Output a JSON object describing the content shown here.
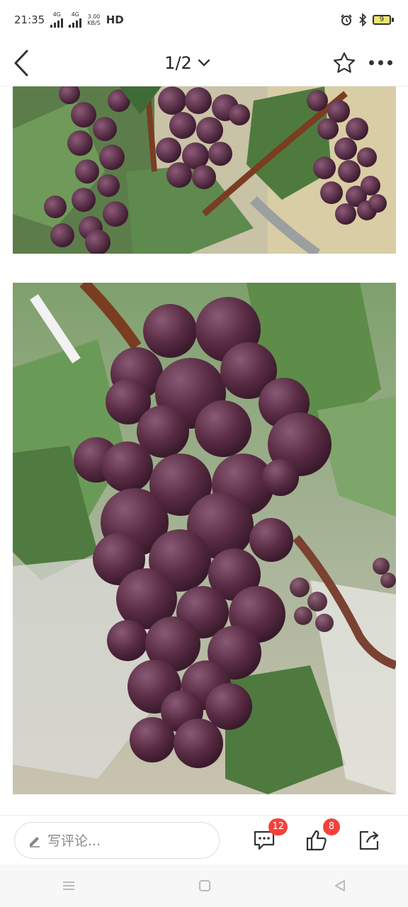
{
  "status_bar": {
    "time": "21:35",
    "network_1": "4G",
    "network_2": "4G",
    "speed_value": "3.00",
    "speed_unit": "KB/S",
    "hd": "HD",
    "battery_level": "9"
  },
  "nav": {
    "page_indicator": "1/2"
  },
  "bottom_bar": {
    "comment_placeholder": "写评论...",
    "comment_count": "12",
    "like_count": "8"
  },
  "colors": {
    "accent": "#f2433b",
    "grape_dark": "#4a2338",
    "grape_bloom": "#7a4a63",
    "leaf": "#4e7a3f"
  },
  "icons": [
    "back-icon",
    "chevron-down-icon",
    "star-icon",
    "more-icon",
    "pencil-icon",
    "comment-icon",
    "thumbs-up-icon",
    "share-icon",
    "menu-icon",
    "home-icon",
    "back-triangle-icon"
  ]
}
